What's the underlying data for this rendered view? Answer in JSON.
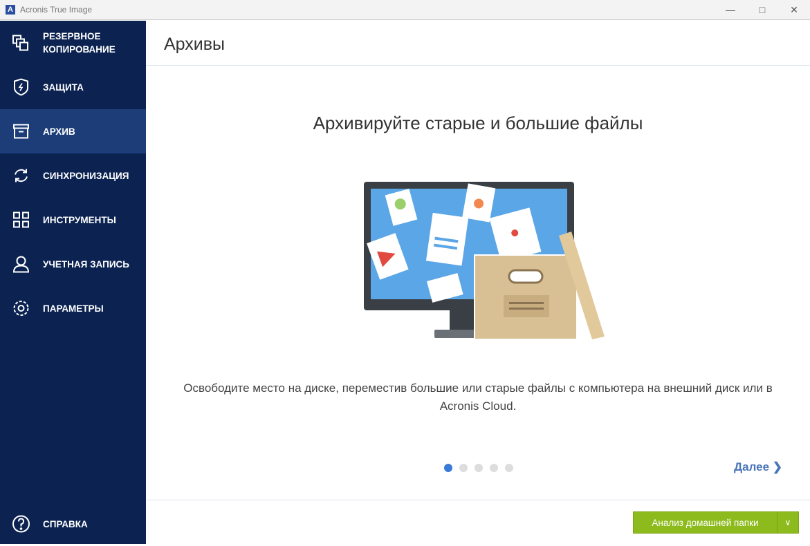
{
  "window": {
    "title": "Acronis True Image",
    "logo": "A"
  },
  "sidebar": {
    "items": [
      {
        "label": "РЕЗЕРВНОЕ КОПИРОВАНИЕ",
        "icon": "backup-icon"
      },
      {
        "label": "ЗАЩИТА",
        "icon": "shield-icon"
      },
      {
        "label": "АРХИВ",
        "icon": "archive-icon"
      },
      {
        "label": "СИНХРОНИЗАЦИЯ",
        "icon": "sync-icon"
      },
      {
        "label": "ИНСТРУМЕНТЫ",
        "icon": "tools-icon"
      },
      {
        "label": "УЧЕТНАЯ ЗАПИСЬ",
        "icon": "account-icon"
      },
      {
        "label": "ПАРАМЕТРЫ",
        "icon": "gear-icon"
      }
    ],
    "help": "СПРАВКА",
    "active": "АРХИВ"
  },
  "main": {
    "title": "Архивы",
    "headline": "Архивируйте старые и большие файлы",
    "description": "Освободите место на диске, переместив большие или старые файлы с компьютера на внешний диск или в Acronis Cloud.",
    "pager": {
      "current": 1,
      "total": 5
    },
    "next_label": "Далее",
    "action_button": "Анализ домашней папки"
  },
  "colors": {
    "sidebar": "#0c2352",
    "active": "#1c3d78",
    "accent": "#8dbb1d",
    "link": "#4a76b8"
  }
}
